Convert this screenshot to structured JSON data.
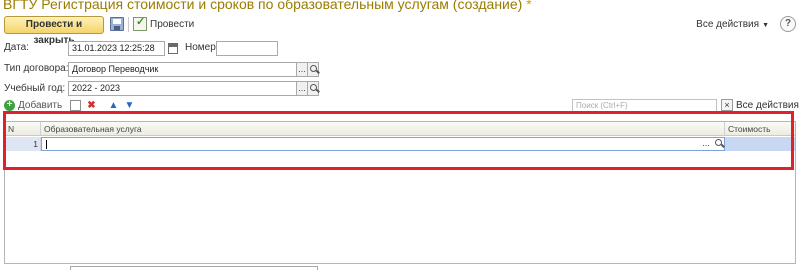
{
  "window": {
    "title": "ВГТУ Регистрация стоимости и сроков по образовательным услугам (создание)",
    "modified_marker": "*"
  },
  "toolbar": {
    "post_and_close_label": "Провести и закрыть",
    "post_label": "Провести",
    "all_actions_label": "Все действия",
    "help_label": "?"
  },
  "form": {
    "date_label": "Дата:",
    "date_value": "31.01.2023 12:25:28",
    "number_label": "Номер:",
    "number_value": "",
    "contract_type_label": "Тип договора:",
    "contract_type_value": "Договор Переводчик",
    "academic_year_label": "Учебный год:",
    "academic_year_value": "2022 - 2023",
    "select_button_label": "..."
  },
  "table_toolbar": {
    "add_label": "Добавить",
    "search_placeholder": "Поиск (Ctrl+F)",
    "clear_label": "×",
    "all_actions_label": "Все действия"
  },
  "table": {
    "columns": [
      "N",
      "Образовательная услуга",
      "Стоимость"
    ],
    "rows": [
      {
        "n": "1",
        "service": "",
        "cost": ""
      }
    ]
  },
  "colors": {
    "title": "#9a7c00",
    "highlight_border": "#e0202a",
    "selected_row": "#e9eef8"
  }
}
